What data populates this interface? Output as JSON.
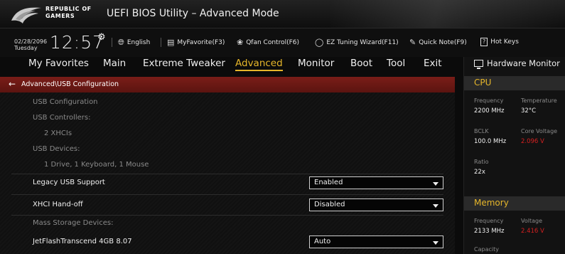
{
  "header": {
    "brand_line1": "REPUBLIC OF",
    "brand_line2": "GAMERS",
    "title": "UEFI BIOS Utility – Advanced Mode"
  },
  "toolbar": {
    "date": "02/28/2096",
    "day": "Tuesday",
    "time": "12:57",
    "language": "English",
    "myfavorite": "MyFavorite(F3)",
    "qfan": "Qfan Control(F6)",
    "ez_tuning": "EZ Tuning Wizard(F11)",
    "quick_note": "Quick Note(F9)",
    "hot_keys": "Hot Keys"
  },
  "menu": [
    "My Favorites",
    "Main",
    "Extreme Tweaker",
    "Advanced",
    "Monitor",
    "Boot",
    "Tool",
    "Exit"
  ],
  "breadcrumb": "Advanced\\USB Configuration",
  "rows": [
    {
      "label": "USB Configuration"
    },
    {
      "label": "USB Controllers:"
    },
    {
      "label": "2 XHCIs"
    },
    {
      "label": "USB Devices:"
    },
    {
      "label": "1 Drive, 1 Keyboard, 1 Mouse"
    },
    {
      "label": "Legacy USB Support",
      "value": "Enabled"
    },
    {
      "label": "XHCI Hand-off",
      "value": "Disabled"
    },
    {
      "label": "Mass Storage Devices:"
    },
    {
      "label": "JetFlashTranscend 4GB 8.07",
      "value": "Auto"
    }
  ],
  "hardware_monitor": {
    "title": "Hardware Monitor",
    "cpu": {
      "section": "CPU",
      "frequency_label": "Frequency",
      "frequency": "2200 MHz",
      "temperature_label": "Temperature",
      "temperature": "32°C",
      "bclk_label": "BCLK",
      "bclk": "100.0 MHz",
      "core_voltage_label": "Core Voltage",
      "core_voltage": "2.096 V",
      "ratio_label": "Ratio",
      "ratio": "22x"
    },
    "memory": {
      "section": "Memory",
      "frequency_label": "Frequency",
      "frequency": "2133 MHz",
      "voltage_label": "Voltage",
      "voltage": "2.416 V",
      "capacity_label": "Capacity"
    }
  },
  "colors": {
    "accent": "#e6b62a",
    "breadcrumb_bg": "#7a1d18",
    "warning": "#d42020"
  }
}
